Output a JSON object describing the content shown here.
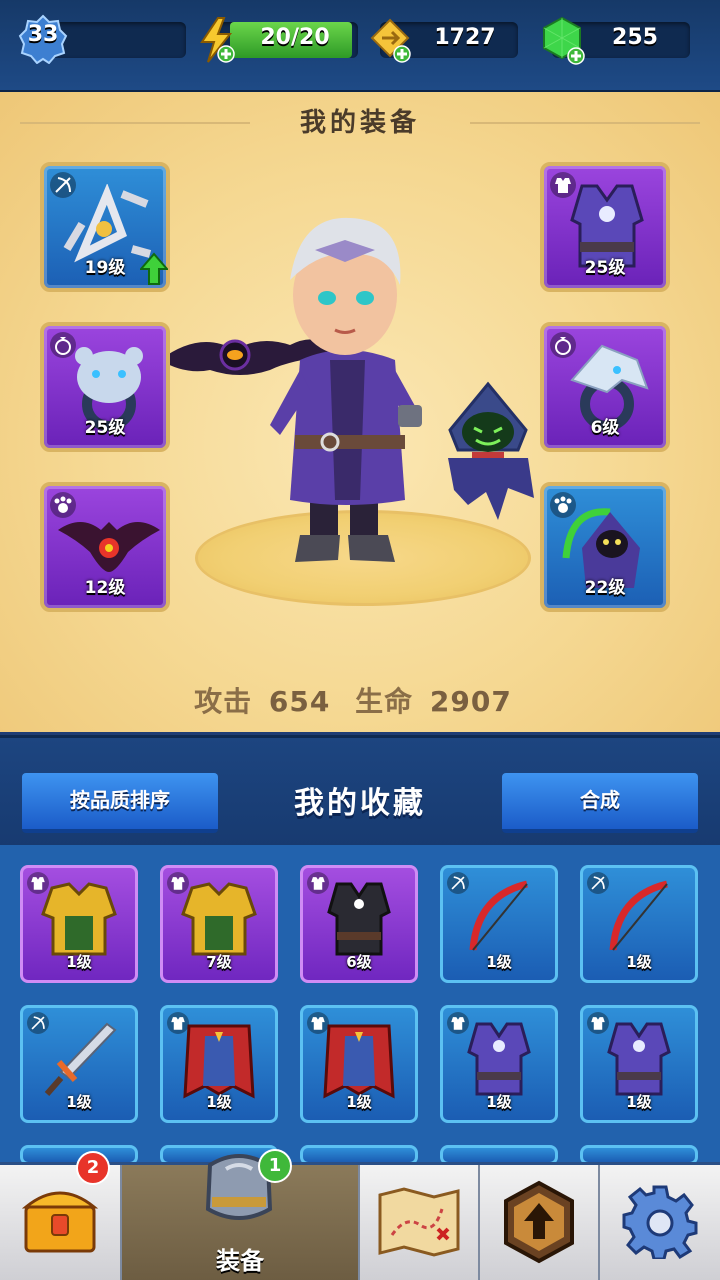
{
  "topbar": {
    "level": "33",
    "energy": "20/20",
    "coins": "1727",
    "gems": "255"
  },
  "equipment": {
    "title": "我的装备",
    "slots_left": [
      {
        "level": "19级",
        "category": "weapon-icon",
        "rarity": "blue",
        "item": "shuriken-icon",
        "upgrade": true
      },
      {
        "level": "25级",
        "category": "ring-icon",
        "rarity": "purple",
        "item": "bear-ring-icon"
      },
      {
        "level": "12级",
        "category": "pet-icon",
        "rarity": "purple",
        "item": "bat-pet-icon"
      }
    ],
    "slots_right": [
      {
        "level": "25级",
        "category": "armor-icon",
        "rarity": "purple",
        "item": "vest-icon"
      },
      {
        "level": "6级",
        "category": "ring-icon",
        "rarity": "purple",
        "item": "eagle-ring-icon"
      },
      {
        "level": "22级",
        "category": "pet-icon",
        "rarity": "blue",
        "item": "reaper-pet-icon"
      }
    ],
    "stats": {
      "attack_label": "攻击",
      "attack": "654",
      "hp_label": "生命",
      "hp": "2907"
    }
  },
  "collection": {
    "sort_button": "按品质排序",
    "title": "我的收藏",
    "merge_button": "合成",
    "items": [
      {
        "level": "1级",
        "rarity": "purple",
        "category": "armor-icon",
        "item": "gold-armor-icon"
      },
      {
        "level": "7级",
        "rarity": "purple",
        "category": "armor-icon",
        "item": "gold-armor-icon"
      },
      {
        "level": "6级",
        "rarity": "purple",
        "category": "armor-icon",
        "item": "dark-vest-icon"
      },
      {
        "level": "1级",
        "rarity": "blue",
        "category": "weapon-icon",
        "item": "red-bow-icon"
      },
      {
        "level": "1级",
        "rarity": "blue",
        "category": "weapon-icon",
        "item": "red-bow-icon"
      },
      {
        "level": "1级",
        "rarity": "blue",
        "category": "weapon-icon",
        "item": "sword-icon"
      },
      {
        "level": "1级",
        "rarity": "blue",
        "category": "armor-icon",
        "item": "red-cape-icon"
      },
      {
        "level": "1级",
        "rarity": "blue",
        "category": "armor-icon",
        "item": "red-cape-icon"
      },
      {
        "level": "1级",
        "rarity": "blue",
        "category": "armor-icon",
        "item": "blue-vest-icon"
      },
      {
        "level": "1级",
        "rarity": "blue",
        "category": "armor-icon",
        "item": "blue-vest-icon"
      }
    ]
  },
  "nav": {
    "chest_badge": "2",
    "equip_badge": "1",
    "equip_label": "装备",
    "items": [
      "chest-icon",
      "armor-icon",
      "map-icon",
      "upgrade-icon",
      "settings-icon"
    ]
  }
}
